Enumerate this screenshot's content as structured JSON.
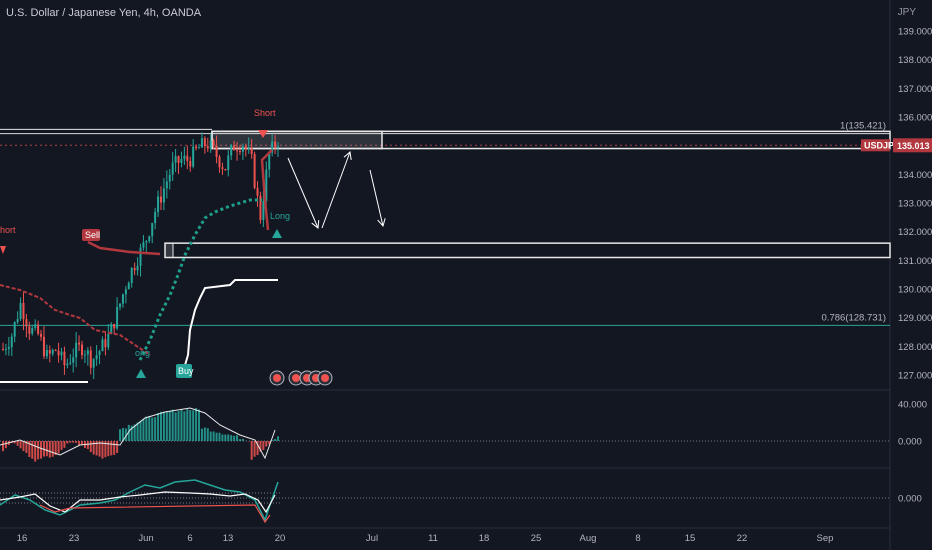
{
  "header": {
    "title": "U.S. Dollar / Japanese Yen, 4h, OANDA",
    "currency": "JPY"
  },
  "price_axis": {
    "ticks": [
      "139.000",
      "138.000",
      "137.000",
      "136.000",
      "135.000",
      "134.000",
      "133.000",
      "132.000",
      "131.000",
      "130.000",
      "129.000",
      "128.000",
      "127.000"
    ]
  },
  "last_price": {
    "symbol": "USDJPY",
    "value": "135.013"
  },
  "fib_levels": [
    {
      "label": "1(135.421)"
    },
    {
      "label": "0.786(128.731)"
    }
  ],
  "signals": {
    "short": "Short",
    "short_left": "hort",
    "sell": "Sell",
    "buy": "Buy",
    "long": "Long",
    "long_left": "ong"
  },
  "time_axis": {
    "labels": [
      "16",
      "23",
      "Jun",
      "6",
      "13",
      "20",
      "Jul",
      "11",
      "18",
      "25",
      "Aug",
      "8",
      "15",
      "22",
      "Sep"
    ]
  },
  "oscillator1": {
    "ticks": [
      "40.000",
      "0.000"
    ]
  },
  "oscillator2": {
    "ticks": [
      "0.000"
    ]
  },
  "colors": {
    "background": "#131722",
    "up": "#26a69a",
    "down": "#ef5350",
    "bearish_line": "#b2383f",
    "bullish_line": "#1f9e8a",
    "fib_teal": "#26a69a",
    "tag_red": "#b2383f"
  },
  "chart_data": {
    "type": "candlestick",
    "title": "U.S. Dollar / Japanese Yen, 4h, OANDA",
    "yunit": "JPY",
    "ylim": [
      126.6,
      139.5
    ],
    "x": [
      "16",
      "23",
      "Jun",
      "6",
      "13",
      "20",
      "Jul",
      "11",
      "18",
      "25",
      "Aug",
      "8",
      "15",
      "22",
      "Sep"
    ],
    "series": [
      {
        "name": "USDJPY",
        "close_path": [
          127.9,
          128.4,
          129.5,
          128.6,
          128.4,
          127.6,
          127.9,
          127.3,
          127.8,
          128.0,
          127.5,
          127.9,
          128.4,
          129.3,
          130.3,
          131.0,
          131.6,
          132.6,
          133.4,
          134.2,
          134.5,
          134.5,
          134.9,
          135.1,
          134.7,
          134.2,
          135.0,
          135.1,
          134.5,
          132.5,
          134.7,
          135.2
        ]
      },
      {
        "name": "fib_1",
        "value": 135.421
      },
      {
        "name": "fib_0.786",
        "value": 128.731
      }
    ],
    "zones": [
      {
        "name": "resistance",
        "from": 134.9,
        "to": 135.5
      },
      {
        "name": "support",
        "from": 131.1,
        "to": 131.6
      }
    ],
    "last": 135.013,
    "oscillator1_range": [
      -10,
      40
    ],
    "grid": false
  }
}
